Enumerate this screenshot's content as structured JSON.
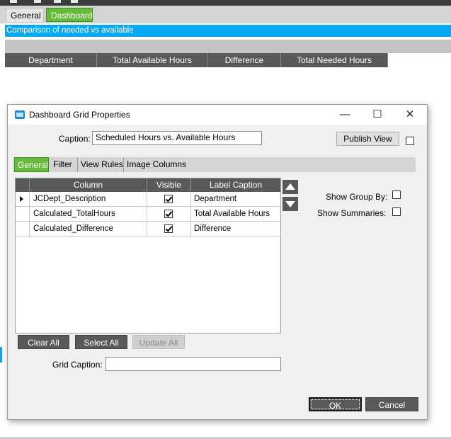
{
  "app": {
    "tabs": [
      {
        "label": "General"
      },
      {
        "label": "Dashboard"
      }
    ],
    "banner": "Comparison of needed vs available",
    "grid_headers": [
      "Department",
      "Total Available Hours",
      "Difference",
      "Total Needed Hours"
    ]
  },
  "dialog": {
    "title": "Dashboard Grid Properties",
    "window_buttons": {
      "minimize": "—",
      "maximize": "☐",
      "close": "✕"
    },
    "caption_label": "Caption:",
    "caption_value": "Scheduled Hours vs. Available Hours",
    "publish_label": "Publish View",
    "tabs": [
      "General",
      "Filter",
      "View Rules",
      "Image Columns"
    ],
    "grid": {
      "headers": [
        "Column",
        "Visible",
        "Label Caption"
      ],
      "rows": [
        {
          "column": "JCDept_Description",
          "visible": true,
          "caption": "Department"
        },
        {
          "column": "Calculated_TotalHours",
          "visible": true,
          "caption": "Total Available Hours"
        },
        {
          "column": "Calculated_Difference",
          "visible": true,
          "caption": "Difference"
        }
      ]
    },
    "show_group_by_label": "Show Group By:",
    "show_summaries_label": "Show Summaries:",
    "clear_all_label": "Clear All",
    "select_all_label": "Select All",
    "update_all_label": "Update All",
    "grid_caption_label": "Grid Caption:",
    "grid_caption_value": "",
    "ok_label": "OK",
    "cancel_label": "Cancel"
  },
  "colors": {
    "tab_active": "#66bb3c",
    "banner": "#06a8f1",
    "header_dark": "#595959"
  }
}
